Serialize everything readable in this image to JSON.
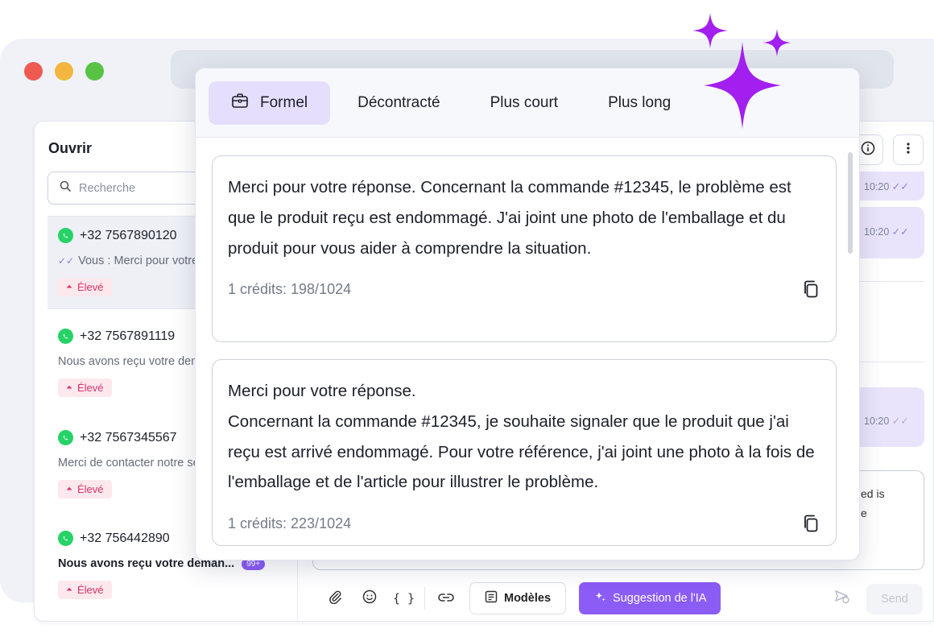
{
  "sidebar": {
    "title": "Ouvrir",
    "search_placeholder": "Recherche",
    "conversations": [
      {
        "phone": "+32 7567890120",
        "preview": "Vous : Merci pour votre réponse.",
        "priority": "Élevé"
      },
      {
        "phone": "+32 7567891119",
        "preview": "Nous avons reçu votre demande",
        "priority": "Élevé"
      },
      {
        "phone": "+32 7567345567",
        "preview": "Merci de contacter notre service",
        "priority": "Élevé"
      },
      {
        "phone": "+32 756442890",
        "preview": "Nous avons reçu votre deman...",
        "unread": "99+",
        "priority": "Élevé"
      }
    ]
  },
  "chat": {
    "times": [
      "10:20",
      "10:20",
      "10:20"
    ],
    "composer_peek_line1": "ed is",
    "composer_peek_line2": "e"
  },
  "toolbar": {
    "models_label": "Modèles",
    "ai_label": "Suggestion de l'IA",
    "send_label": "Send"
  },
  "popup": {
    "tabs": [
      {
        "label": "Formel",
        "active": true
      },
      {
        "label": "Décontracté"
      },
      {
        "label": "Plus court"
      },
      {
        "label": "Plus long"
      }
    ],
    "suggestions": [
      {
        "lines": [
          "Merci pour votre réponse. Concernant la commande #12345, le problème est que le produit reçu est endommagé. J'ai joint une photo de l'emballage et du produit pour vous aider à comprendre la situation."
        ],
        "credits": "1 crédits: 198/1024"
      },
      {
        "lines": [
          "Merci pour votre réponse.",
          "Concernant la commande #12345, je souhaite signaler que le produit que j'ai reçu est arrivé endommagé. Pour votre référence, j'ai joint une photo à la fois de l'emballage et de l'article pour illustrer le problème."
        ],
        "credits": "1 crédits: 223/1024"
      }
    ]
  },
  "colors": {
    "accent": "#8b5cf6",
    "sparkle": "#a21ff0",
    "active_tab": "#e5defc",
    "priority_text": "#d6336c",
    "priority_bg": "#fde8ee"
  }
}
